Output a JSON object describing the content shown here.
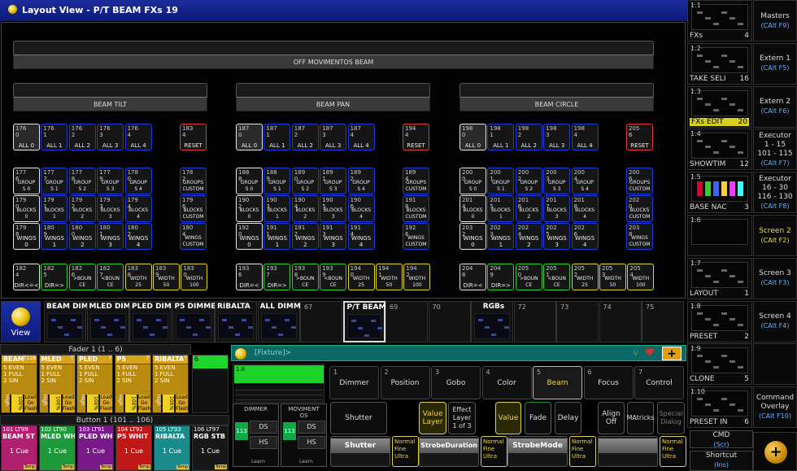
{
  "title": "Layout View - P/T BEAM FXs 19",
  "groups": {
    "off": "OFF MOVIMENTOS BEAM",
    "tilt": "BEAM TILT",
    "pan": "BEAM PAN",
    "circle": "BEAM CIRCLE"
  },
  "sec1": [
    [
      {
        "n": "176\n0",
        "l": "ALL 0"
      },
      {
        "n": "176\n1",
        "l": "ALL 1"
      },
      {
        "n": "176\n2",
        "l": "ALL 2"
      },
      {
        "n": "176\n3",
        "l": "ALL 3"
      },
      {
        "n": "176\n4",
        "l": "ALL 4"
      },
      {
        "n": "183\n4",
        "l": "RESET"
      }
    ],
    [
      {
        "n": "177\n6",
        "l": "GROUP\nS 0"
      },
      {
        "n": "177\n7",
        "l": "GROUP\nS 1"
      },
      {
        "n": "177\n8",
        "l": "GROUP\nS 2"
      },
      {
        "n": "177\n9",
        "l": "GROUP\nS 3"
      },
      {
        "n": "178\n0",
        "l": "GROUP\nS 4"
      },
      {
        "n": "178\n2",
        "l": "GROUPS\nCUSTOM"
      }
    ],
    [
      {
        "n": "179\n0",
        "l": "BLOCKS\n0"
      },
      {
        "n": "179\n1",
        "l": "BLOCKS\n1"
      },
      {
        "n": "179\n2",
        "l": "BLOCKS\n2"
      },
      {
        "n": "179\n3",
        "l": "BLOCKS\n3"
      },
      {
        "n": "179\n4",
        "l": "BLOCKS\n4"
      },
      {
        "n": "179\n6",
        "l": "BLOCKS\nCUSTOM"
      }
    ],
    [
      {
        "n": "179\n8",
        "l": "WINGS\n0"
      },
      {
        "n": "180\n9",
        "l": "WINGS\n1"
      },
      {
        "n": "180\n0",
        "l": "WINGS\n2"
      },
      {
        "n": "180\n1",
        "l": "WINGS\n3"
      },
      {
        "n": "180\n2",
        "l": "WINGS\n4"
      },
      {
        "n": "180\n4",
        "l": "WINGS\nCUSTOM"
      }
    ],
    [
      {
        "n": "182\n4",
        "l": "DIR<=<"
      },
      {
        "n": "182\n5",
        "l": "DIR=>"
      },
      {
        "n": "182\n6",
        "l": ">BOUN\nCE"
      },
      {
        "n": "182\n7",
        "l": "<BOUN\nCE"
      },
      {
        "n": "183\n8",
        "l": "WIDTH\n25"
      },
      {
        "n": "183\n9",
        "l": "WIDTH\n50"
      },
      {
        "n": "183\n0",
        "l": "WIDTH\n100"
      }
    ]
  ],
  "sec2": [
    [
      {
        "n": "187\n0",
        "l": "ALL 0"
      },
      {
        "n": "187\n1",
        "l": "ALL 1"
      },
      {
        "n": "187\n2",
        "l": "ALL 2"
      },
      {
        "n": "187\n3",
        "l": "ALL 3"
      },
      {
        "n": "187\n4",
        "l": "ALL 4"
      },
      {
        "n": "194\n4",
        "l": "RESET"
      }
    ],
    [
      {
        "n": "188\n8",
        "l": "GROUP\nS 0"
      },
      {
        "n": "188\n9",
        "l": "GROUP\nS 1"
      },
      {
        "n": "189\n0",
        "l": "GROUP\nS 2"
      },
      {
        "n": "189\n1",
        "l": "GROUP\nS 3"
      },
      {
        "n": "189\n2",
        "l": "GROUP\nS 4"
      },
      {
        "n": "189\n4",
        "l": "GROUPS\nCUSTOM"
      }
    ],
    [
      {
        "n": "190\n2",
        "l": "BLOCKS\n0"
      },
      {
        "n": "190\n3",
        "l": "BLOCKS\n1"
      },
      {
        "n": "190\n4",
        "l": "BLOCKS\n2"
      },
      {
        "n": "190\n5",
        "l": "BLOCKS\n3"
      },
      {
        "n": "190\n6",
        "l": "BLOCKS\n4"
      },
      {
        "n": "191\n8",
        "l": "BLOCKS\nCUSTOM"
      }
    ],
    [
      {
        "n": "192\n0",
        "l": "WINGS\n0"
      },
      {
        "n": "191\n1",
        "l": "WINGS\n1"
      },
      {
        "n": "191\n2",
        "l": "WINGS\n2"
      },
      {
        "n": "191\n3",
        "l": "WINGS\n3"
      },
      {
        "n": "191\n4",
        "l": "WINGS\n4"
      },
      {
        "n": "192\n6",
        "l": "WINGS\nCUSTOM"
      }
    ],
    [
      {
        "n": "193\n6",
        "l": "DIR=<"
      },
      {
        "n": "193\n7",
        "l": "DIR=>"
      },
      {
        "n": "193\n8",
        "l": ">BOUN\nCE"
      },
      {
        "n": "193\n9",
        "l": "<BOUN\nCE"
      },
      {
        "n": "194\n0",
        "l": "WIDTH\n25"
      },
      {
        "n": "194\n1",
        "l": "WIDTH\n50"
      },
      {
        "n": "194\n2",
        "l": "WIDTH\n100"
      }
    ]
  ],
  "sec3": [
    [
      {
        "n": "198\n0",
        "l": "ALL 0"
      },
      {
        "n": "198\n1",
        "l": "ALL 1"
      },
      {
        "n": "198\n2",
        "l": "ALL 2"
      },
      {
        "n": "198\n3",
        "l": "ALL 3"
      },
      {
        "n": "198\n4",
        "l": "ALL 4"
      },
      {
        "n": "205\n6",
        "l": "RESET"
      }
    ],
    [
      {
        "n": "200\n0",
        "l": "GROUP\nS 0"
      },
      {
        "n": "200\n1",
        "l": "GROUP\nS 1"
      },
      {
        "n": "200\n2",
        "l": "GROUP\nS 2"
      },
      {
        "n": "200\n3",
        "l": "GROUP\nS 3"
      },
      {
        "n": "200\n4",
        "l": "GROUP\nS 4"
      },
      {
        "n": "200\n6",
        "l": "GROUPS\nCUSTOM"
      }
    ],
    [
      {
        "n": "201\n4",
        "l": "BLOCKS\n0"
      },
      {
        "n": "201\n5",
        "l": "BLOCKS\n1"
      },
      {
        "n": "201\n6",
        "l": "BLOCKS\n2"
      },
      {
        "n": "201\n7",
        "l": "BLOCKS\n3"
      },
      {
        "n": "201\n8",
        "l": "BLOCKS\n4"
      },
      {
        "n": "202\n0",
        "l": "BLOCKS\nCUSTOM"
      }
    ],
    [
      {
        "n": "203\n2",
        "l": "WINGS\n0"
      },
      {
        "n": "202\n3",
        "l": "WINGS\n1"
      },
      {
        "n": "202\n4",
        "l": "WINGS\n2"
      },
      {
        "n": "202\n5",
        "l": "WINGS\n3"
      },
      {
        "n": "202\n6",
        "l": "WINGS\n4"
      },
      {
        "n": "203\n8",
        "l": "WINGS\nCUSTOM"
      }
    ],
    [
      {
        "n": "204\n8",
        "l": "DIR=<"
      },
      {
        "n": "204\n9",
        "l": "DIR=>"
      },
      {
        "n": "205\n0",
        "l": ">BOUN\nCE"
      },
      {
        "n": "205\n1",
        "l": "<BOUN\nCE"
      },
      {
        "n": "205\n2",
        "l": "WIDTH\n25"
      },
      {
        "n": "205\n3",
        "l": "WIDTH\n50"
      },
      {
        "n": "205\n4",
        "l": "WIDTH\n100"
      }
    ]
  ],
  "view_label": "View",
  "views": [
    {
      "t": "BEAM DIM"
    },
    {
      "t": "MLED DIM"
    },
    {
      "t": "PLED DIM"
    },
    {
      "t": "P5 DIMME"
    },
    {
      "t": "RIBALTA"
    },
    {
      "t": "ALL DIMM"
    },
    {
      "t": "67"
    },
    {
      "t": "P/T BEAM"
    },
    {
      "t": "69"
    },
    {
      "t": "70"
    },
    {
      "t": "RGBs"
    },
    {
      "t": "72"
    },
    {
      "t": "73"
    },
    {
      "t": "74"
    },
    {
      "t": "75"
    }
  ],
  "fader_header": "Fader   1 (1 .. 6)",
  "faders": [
    {
      "nm": "BEAM",
      "num": "T128",
      "r1": "5 EVEN",
      "r2": "1 FULL",
      "r3": "2 SIN",
      "hi": "High",
      "pct": "100%",
      "ld": "Load\nGo\nFlash"
    },
    {
      "nm": "MLED",
      "num": "T",
      "r1": "5 EVEN",
      "r2": "1 FULL",
      "r3": "2 SIN",
      "hi": "High",
      "pct": "100%",
      "ld": "Load\nGo\nFlash"
    },
    {
      "nm": "PLED",
      "num": "T",
      "r1": "5 EVEN",
      "r2": "1 FULL",
      "r3": "2 SIN",
      "hi": "High",
      "pct": "100%",
      "ld": "Load\nGo\nFlash"
    },
    {
      "nm": "P5",
      "num": "T",
      "r1": "5 EVEN",
      "r2": "1 FULL",
      "r3": "2 SIN",
      "hi": "High",
      "pct": "100%",
      "ld": "Load\nGo\nFlash"
    },
    {
      "nm": "RIBALTA",
      "num": "T",
      "r1": "5 EVEN",
      "r2": "1 FULL",
      "r3": "2 SIN",
      "hi": "High",
      "pct": "100%",
      "ld": "Load\nGo\nFlash"
    }
  ],
  "exec6": "6",
  "button_header": "Button   1 (101 .. 106)",
  "buttons": [
    {
      "nm": "BEAM ST",
      "num": "101 LT99",
      "cue": "1 Cue",
      "tmp": "Temp",
      "bg": "#b02070"
    },
    {
      "nm": "MLED WH",
      "num": "102 LT90",
      "cue": "1 Cue",
      "tmp": "Temp",
      "bg": "#1f9a3a"
    },
    {
      "nm": "PLED WH",
      "num": "103 LT91",
      "cue": "1 Cue",
      "tmp": "Temp",
      "bg": "#7a1a8a"
    },
    {
      "nm": "P5 WHIT",
      "num": "104 LT92",
      "cue": "1 Cue",
      "tmp": "Temp",
      "bg": "#c01818"
    },
    {
      "nm": "RIBALTA",
      "num": "105 LT93",
      "cue": "1 Cue",
      "tmp": "Temp",
      "bg": "#1a8a8a"
    },
    {
      "nm": "RGB STB",
      "num": "106 LT97",
      "cue": "1 Cue",
      "tmp": "Temp",
      "bg": "#181818"
    }
  ],
  "fixture_title": "[Fixture]>",
  "preset_pane": "1.6",
  "tabs": [
    {
      "n": "1",
      "l": "Dimmer"
    },
    {
      "n": "2",
      "l": "Position"
    },
    {
      "n": "3",
      "l": "Gobo"
    },
    {
      "n": "4",
      "l": "Color"
    },
    {
      "n": "5",
      "l": "Beam"
    },
    {
      "n": "6",
      "l": "Focus"
    },
    {
      "n": "7",
      "l": "Control"
    }
  ],
  "enc_dimmer": {
    "t": "DIMMER",
    "v": "113",
    "a": "DS",
    "b": "HS",
    "c": "Learn"
  },
  "enc_move": {
    "t": "MOVIMENT\nOS",
    "v": "113",
    "a": "DS",
    "b": "HS",
    "c": "Learn"
  },
  "btns": {
    "shutter": "Shutter",
    "valuelayer": "Value\nLayer",
    "effectlayer": "Effect\nLayer\n1 of 3",
    "value": "Value",
    "fade": "Fade",
    "delay": "Delay",
    "alignoff": "Align\nOff",
    "matricks": "MAtricks",
    "special": "Special\nDialog"
  },
  "encoders": [
    {
      "l": "Shutter"
    },
    {
      "l": "StrobeDuration"
    },
    {
      "l": "StrobeMode"
    },
    {
      "l": ""
    }
  ],
  "encmode": {
    "a": "Normal",
    "b": "Fine",
    "c": "Ultra"
  },
  "right_panes": [
    {
      "no": "1.1",
      "cap": "FXs",
      "num": "4"
    },
    {
      "no": "1.2",
      "cap": "TAKE SELI",
      "num": "16"
    },
    {
      "no": "1.3",
      "cap": "FXs EDIT",
      "num": "20"
    },
    {
      "no": "1.4",
      "cap": "SHOWTIM",
      "num": "12"
    },
    {
      "no": "1.5",
      "cap": "BASE NAC",
      "num": "3"
    },
    {
      "no": "1.6",
      "cap": "",
      "num": ""
    },
    {
      "no": "1.7",
      "cap": "LAYOUT",
      "num": "1"
    },
    {
      "no": "1.8",
      "cap": "PRESET",
      "num": "2"
    },
    {
      "no": "1.9",
      "cap": "CLONE",
      "num": "5"
    },
    {
      "no": "1.10",
      "cap": "PRESET IN",
      "num": "6"
    }
  ],
  "right_btns": [
    {
      "l": "Masters",
      "k": "(CAlt F9)"
    },
    {
      "l": "Extern 1",
      "k": "(CAlt F5)"
    },
    {
      "l": "Extern 2",
      "k": "(CAlt F6)"
    },
    {
      "l": "Executor\n1 - 15\n101 - 115",
      "k": "(CAlt F7)"
    },
    {
      "l": "Executor\n16 - 30\n116 - 130",
      "k": "(CAlt F8)"
    },
    {
      "l": "Screen 2",
      "k": "(CAlt F2)"
    },
    {
      "l": "Screen 3",
      "k": "(CAlt F3)"
    },
    {
      "l": "Screen 4",
      "k": "(CAlt F4)"
    },
    {
      "l": "",
      "k": ""
    },
    {
      "l": "Command\nOverlay",
      "k": "(CAlt F10)"
    }
  ],
  "cmd": {
    "l": "CMD",
    "k": "(Scr)"
  },
  "shortcut": {
    "l": "Shortcut",
    "k": "(Ins)"
  }
}
